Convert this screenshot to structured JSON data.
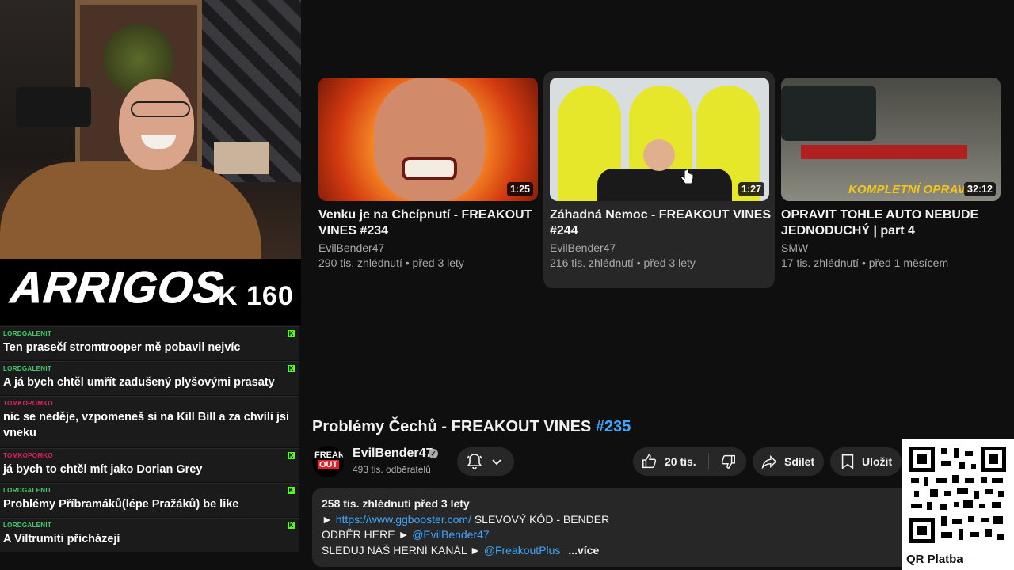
{
  "stream_overlay": {
    "logo_text": "ARRIGOS",
    "counter": "K 160"
  },
  "chat": {
    "messages": [
      {
        "user": "LORDGALENIT",
        "user_color": "#3fd16a",
        "text": "Ten prasečí stromtrooper mě pobavil nejvíc"
      },
      {
        "user": "LORDGALENIT",
        "user_color": "#3fd16a",
        "text": "A já bych chtěl umřít zadušený plyšovými prasaty"
      },
      {
        "user": "TOMKOPOMKO",
        "user_color": "#e0245e",
        "text": "nic se neděje, vzpomeneš si na Kill Bill a za chvíli jsi vneku"
      },
      {
        "user": "TOMKOPOMKO",
        "user_color": "#e0245e",
        "text": "já bych to chtěl mít jako Dorian Grey"
      },
      {
        "user": "LORDGALENIT",
        "user_color": "#3fd16a",
        "text": "Problémy Příbramáků(lépe Pražáků) be like"
      },
      {
        "user": "LORDGALENIT",
        "user_color": "#3fd16a",
        "text": "A Viltrumiti přicházejí"
      }
    ],
    "badge_icon": "kick-icon",
    "badge_color": "#53fc18"
  },
  "related_videos": [
    {
      "title": "Venku je na Chcípnutí - FREAKOUT VINES #234",
      "channel": "EvilBender47",
      "stats": "290 tis. zhlédnutí • před 3 lety",
      "duration": "1:25"
    },
    {
      "title": "Záhadná Nemoc - FREAKOUT VINES #244",
      "channel": "EvilBender47",
      "stats": "216 tis. zhlédnutí • před 3 lety",
      "duration": "1:27"
    },
    {
      "title": "OPRAVIT TOHLE AUTO NEBUDE JEDNODUCHÝ | part 4",
      "channel": "SMW",
      "stats": "17 tis. zhlédnutí • před 1 měsícem",
      "duration": "32:12",
      "thumb_text": "KOMPLETNÍ OPRAVA"
    }
  ],
  "video": {
    "title": "Problémy Čechů - FREAKOUT VINES ",
    "title_hashtag": "#235",
    "channel": {
      "name": "EvilBender47",
      "subscribers": "493 tis. odběratelů",
      "avatar_top": "FREAK",
      "avatar_bottom": "OUT"
    },
    "actions": {
      "likes": "20 tis.",
      "share_label": "Sdílet",
      "save_label": "Uložit"
    },
    "description": {
      "stats": "258 tis. zhlédnutí  před 3 lety",
      "line1_prefix": "► ",
      "line1_link": "https://www.ggbooster.com/",
      "line1_suffix": " SLEVOVÝ KÓD - BENDER",
      "line2_prefix": "ODBĚR HERE ► ",
      "line2_link": "@EvilBender47",
      "line3_prefix": "SLEDUJ NÁŠ HERNÍ KANÁL ► ",
      "line3_link": "@FreakoutPlus",
      "more_label": "...více"
    }
  },
  "qr": {
    "label": "QR Platba"
  },
  "colors": {
    "background": "#0f0f0f",
    "surface": "#272727",
    "link": "#3ea6ff",
    "secondary_text": "#aaaaaa"
  }
}
